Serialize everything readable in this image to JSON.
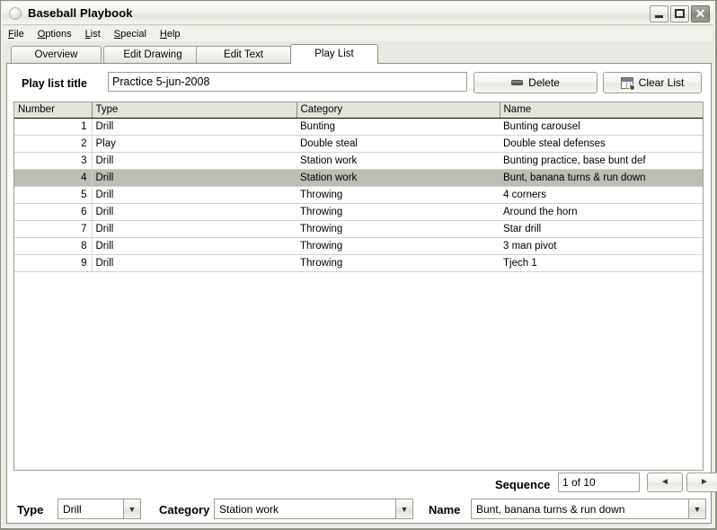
{
  "window": {
    "title": "Baseball Playbook",
    "controls": {
      "minimize": "minimize",
      "maximize": "maximize",
      "close": "✕"
    }
  },
  "menubar": {
    "items": [
      {
        "label": "File",
        "accesskey": "F"
      },
      {
        "label": "Options",
        "accesskey": "O"
      },
      {
        "label": "List",
        "accesskey": "L"
      },
      {
        "label": "Special",
        "accesskey": "S"
      },
      {
        "label": "Help",
        "accesskey": "H"
      }
    ]
  },
  "tabs": [
    {
      "label": "Overview",
      "active": false
    },
    {
      "label": "Edit Drawing",
      "active": false
    },
    {
      "label": "Edit Text",
      "active": false
    },
    {
      "label": "Play List",
      "active": true
    }
  ],
  "toolbar": {
    "playlist_title_label": "Play list title",
    "playlist_title_value": "Practice 5-jun-2008",
    "delete_label": "Delete",
    "clear_list_label": "Clear List"
  },
  "grid": {
    "columns": [
      "Number",
      "Type",
      "Category",
      "Name"
    ],
    "selected_row_index": 3,
    "rows": [
      {
        "number": "1",
        "type": "Drill",
        "category": "Bunting",
        "name": "Bunting carousel"
      },
      {
        "number": "2",
        "type": "Play",
        "category": "Double steal",
        "name": "Double steal defenses"
      },
      {
        "number": "3",
        "type": "Drill",
        "category": "Station work",
        "name": "Bunting practice, base bunt def"
      },
      {
        "number": "4",
        "type": "Drill",
        "category": "Station work",
        "name": "Bunt, banana turns & run down"
      },
      {
        "number": "5",
        "type": "Drill",
        "category": "Throwing",
        "name": "4 corners"
      },
      {
        "number": "6",
        "type": "Drill",
        "category": "Throwing",
        "name": "Around the horn"
      },
      {
        "number": "7",
        "type": "Drill",
        "category": "Throwing",
        "name": "Star drill"
      },
      {
        "number": "8",
        "type": "Drill",
        "category": "Throwing",
        "name": "3 man pivot"
      },
      {
        "number": "9",
        "type": "Drill",
        "category": "Throwing",
        "name": "Tjech 1"
      }
    ]
  },
  "sequence": {
    "label": "Sequence",
    "value": "1 of 10",
    "prev_glyph": "◄",
    "next_glyph": "►"
  },
  "bottom": {
    "type_label": "Type",
    "type_value": "Drill",
    "category_label": "Category",
    "category_value": "Station work",
    "name_label": "Name",
    "name_value": "Bunt, banana turns & run down",
    "dropdown_glyph": "▼"
  },
  "colors": {
    "frame": "#8d8d82",
    "titlebar_bg": "#f2f2ec",
    "selection": "#bdbdb6",
    "header_bg": "#e4e4dc",
    "content_bg": "#ffffff"
  }
}
